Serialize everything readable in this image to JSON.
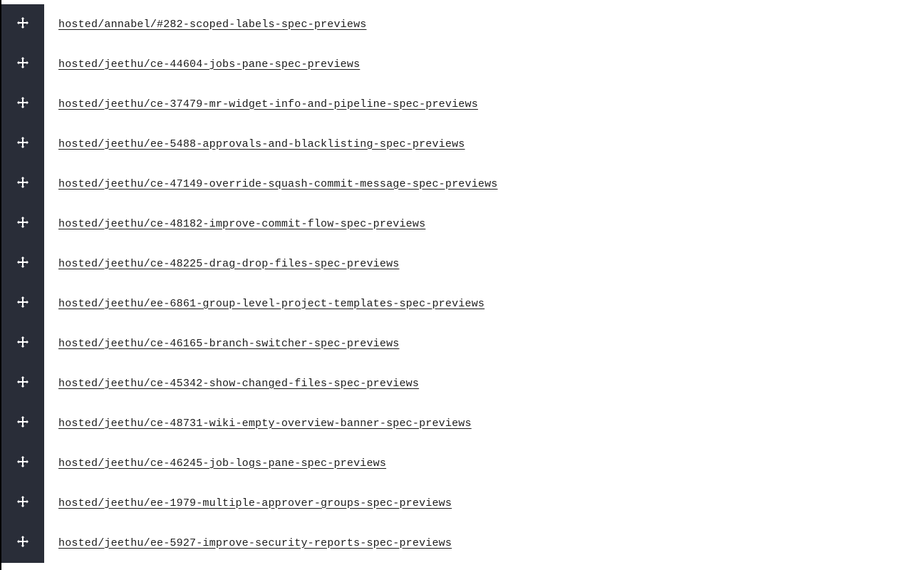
{
  "links": [
    {
      "text": "hosted/annabel/#282-scoped-labels-spec-previews"
    },
    {
      "text": "hosted/jeethu/ce-44604-jobs-pane-spec-previews"
    },
    {
      "text": "hosted/jeethu/ce-37479-mr-widget-info-and-pipeline-spec-previews"
    },
    {
      "text": "hosted/jeethu/ee-5488-approvals-and-blacklisting-spec-previews"
    },
    {
      "text": "hosted/jeethu/ce-47149-override-squash-commit-message-spec-previews"
    },
    {
      "text": "hosted/jeethu/ce-48182-improve-commit-flow-spec-previews"
    },
    {
      "text": "hosted/jeethu/ce-48225-drag-drop-files-spec-previews"
    },
    {
      "text": "hosted/jeethu/ee-6861-group-level-project-templates-spec-previews"
    },
    {
      "text": "hosted/jeethu/ce-46165-branch-switcher-spec-previews"
    },
    {
      "text": "hosted/jeethu/ce-45342-show-changed-files-spec-previews"
    },
    {
      "text": "hosted/jeethu/ce-48731-wiki-empty-overview-banner-spec-previews"
    },
    {
      "text": "hosted/jeethu/ce-46245-job-logs-pane-spec-previews"
    },
    {
      "text": "hosted/jeethu/ee-1979-multiple-approver-groups-spec-previews"
    },
    {
      "text": "hosted/jeethu/ee-5927-improve-security-reports-spec-previews"
    }
  ],
  "icons": {
    "move": "move-icon"
  }
}
